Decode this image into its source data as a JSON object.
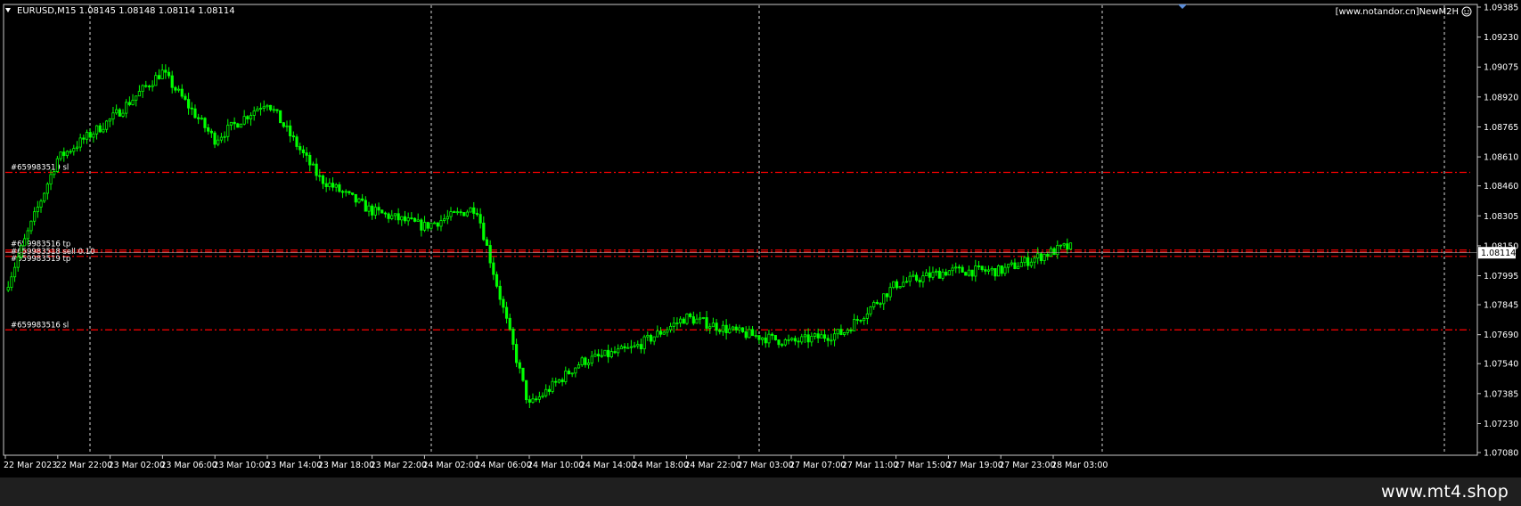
{
  "header": {
    "symbol_line": "EURUSD,M15  1.08145 1.08148 1.08114 1.08114",
    "indicator_label": "[www.notandor.cn]NewM2H"
  },
  "footer": {
    "brand": "www.mt4.shop"
  },
  "colors": {
    "background": "#000000",
    "frame": "#c8c8c8",
    "candle": "#00ff00",
    "order_line": "#ff0000",
    "period_sep": "#ffffff",
    "price_tag_bg": "#ffffff",
    "price_tag_text": "#000000",
    "footer_bg": "#1f1f1f"
  },
  "chart_data": {
    "type": "candlestick",
    "symbol": "EURUSD",
    "timeframe": "M15",
    "current_price": "1.08114",
    "y_ticks": [
      "1.09385",
      "1.09230",
      "1.09075",
      "1.08920",
      "1.08765",
      "1.08610",
      "1.08460",
      "1.08305",
      "1.08150",
      "1.07995",
      "1.07845",
      "1.07690",
      "1.07540",
      "1.07385",
      "1.07230",
      "1.07080"
    ],
    "ylim": [
      1.0708,
      1.09385
    ],
    "x_ticks": [
      "22 Mar 2023",
      "22 Mar 22:00",
      "23 Mar 02:00",
      "23 Mar 06:00",
      "23 Mar 10:00",
      "23 Mar 14:00",
      "23 Mar 18:00",
      "23 Mar 22:00",
      "24 Mar 02:00",
      "24 Mar 06:00",
      "24 Mar 10:00",
      "24 Mar 14:00",
      "24 Mar 18:00",
      "24 Mar 22:00",
      "27 Mar 03:00",
      "27 Mar 07:00",
      "27 Mar 11:00",
      "27 Mar 15:00",
      "27 Mar 19:00",
      "27 Mar 23:00",
      "28 Mar 03:00"
    ],
    "order_lines": [
      {
        "label": "#659983519 sl",
        "price": 1.0853
      },
      {
        "label": "#659983516 tp",
        "price": 1.08128
      },
      {
        "label": "#659983518 sell 0.10",
        "price": 1.08118
      },
      {
        "label": "#659983519 tp",
        "price": 1.08095
      },
      {
        "label": "#659983516 sl",
        "price": 1.07715
      }
    ],
    "price_path": [
      [
        "22 Mar 2023",
        1.0792
      ],
      [
        "22 Mar 22:00",
        1.086
      ],
      [
        "23 Mar 02:00",
        1.088
      ],
      [
        "23 Mar 06:00",
        1.0905
      ],
      [
        "23 Mar 10:00",
        1.087
      ],
      [
        "23 Mar 14:00",
        1.089
      ],
      [
        "23 Mar 18:00",
        1.085
      ],
      [
        "23 Mar 22:00",
        1.0833
      ],
      [
        "24 Mar 02:00",
        1.0825
      ],
      [
        "24 Mar 06:00",
        1.0835
      ],
      [
        "24 Mar 10:00",
        1.0732
      ],
      [
        "24 Mar 14:00",
        1.0755
      ],
      [
        "24 Mar 18:00",
        1.0762
      ],
      [
        "24 Mar 22:00",
        1.0778
      ],
      [
        "27 Mar 03:00",
        1.077
      ],
      [
        "27 Mar 07:00",
        1.0765
      ],
      [
        "27 Mar 11:00",
        1.077
      ],
      [
        "27 Mar 15:00",
        1.0795
      ],
      [
        "27 Mar 19:00",
        1.0802
      ],
      [
        "27 Mar 23:00",
        1.0802
      ],
      [
        "28 Mar 03:00",
        1.0812
      ]
    ],
    "grid": false,
    "period_separators": true
  }
}
